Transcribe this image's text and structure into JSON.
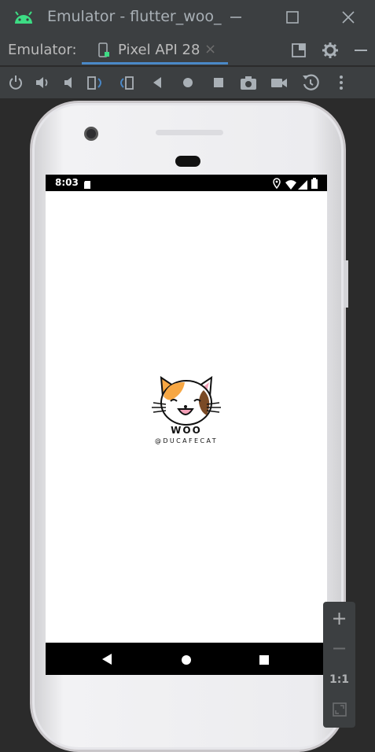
{
  "window": {
    "title": "Emulator - flutter_woo_",
    "icon": "android-icon",
    "controls": [
      "minimize-icon",
      "maximize-icon",
      "close-icon"
    ]
  },
  "tabs": {
    "label": "Emulator:",
    "active_tab": "Pixel API 28",
    "tab_close": "×"
  },
  "toolbar": {
    "items": [
      "power-icon",
      "volume-up-icon",
      "volume-down-icon",
      "rotate-left-icon",
      "rotate-right-icon",
      "back-icon",
      "home-icon",
      "overview-icon",
      "screenshot-icon",
      "record-icon",
      "snapshot-icon",
      "more-icon"
    ]
  },
  "device": {
    "status_time": "8:03",
    "app": {
      "brand_name": "WOO",
      "handle": "@DUCAFECAT"
    }
  },
  "zoom": {
    "plus": "+",
    "minus": "−",
    "actual": "1:1"
  },
  "colors": {
    "accent": "#4a88c7",
    "android_green": "#3ddc84",
    "ide_bg": "#3c3f41"
  }
}
